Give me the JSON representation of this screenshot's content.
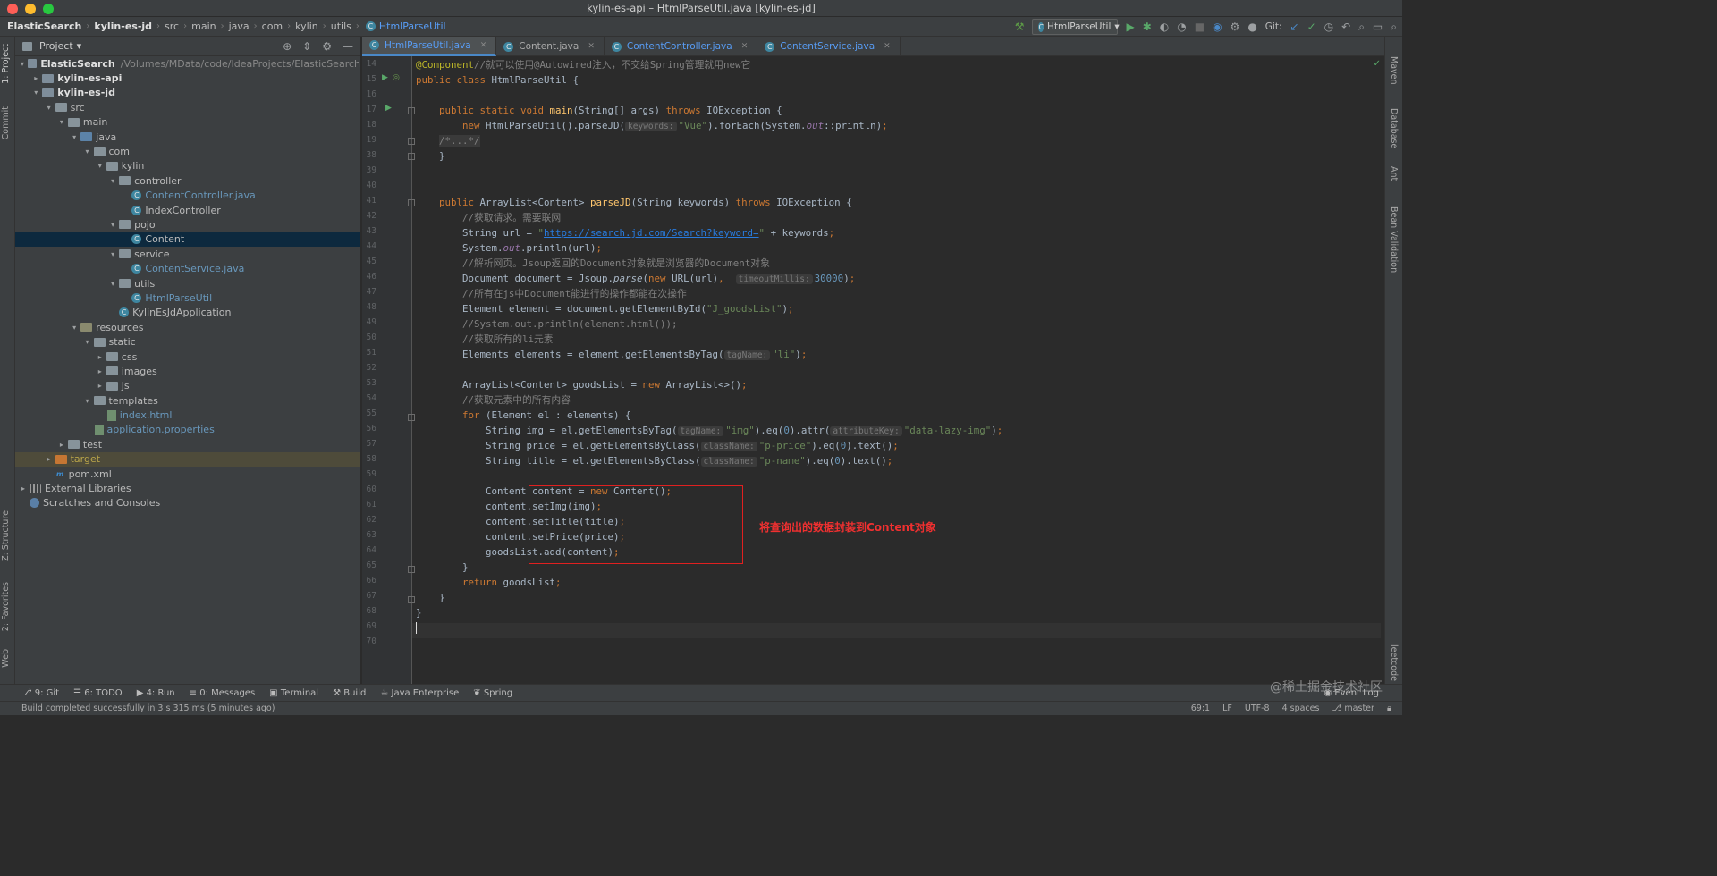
{
  "window": {
    "title": "kylin-es-api – HtmlParseUtil.java [kylin-es-jd]",
    "traffic_colors": [
      "#fe5f57",
      "#febc2e",
      "#28c840"
    ]
  },
  "breadcrumb": [
    "ElasticSearch",
    "kylin-es-jd",
    "src",
    "main",
    "java",
    "com",
    "kylin",
    "utils",
    "HtmlParseUtil"
  ],
  "toolbar": {
    "run_config": "HtmlParseUtil",
    "git_label": "Git:"
  },
  "left_strip": [
    "1: Project",
    "Commit",
    "Z: Structure",
    "2: Favorites",
    "Web"
  ],
  "right_strip": [
    "Maven",
    "Database",
    "Ant",
    "Bean Validation",
    "leetcode"
  ],
  "project": {
    "header": "Project",
    "tree": [
      {
        "label": "ElasticSearch",
        "suffix": "/Volumes/MData/code/IdeaProjects/ElasticSearch",
        "depth": 0,
        "arrow": "▾",
        "icon": "mod",
        "bold": true
      },
      {
        "label": "kylin-es-api",
        "depth": 1,
        "arrow": "▸",
        "icon": "mod",
        "bold": true
      },
      {
        "label": "kylin-es-jd",
        "depth": 1,
        "arrow": "▾",
        "icon": "mod",
        "bold": true
      },
      {
        "label": "src",
        "depth": 2,
        "arrow": "▾",
        "icon": "folder"
      },
      {
        "label": "main",
        "depth": 3,
        "arrow": "▾",
        "icon": "folder"
      },
      {
        "label": "java",
        "depth": 4,
        "arrow": "▾",
        "icon": "src"
      },
      {
        "label": "com",
        "depth": 5,
        "arrow": "▾",
        "icon": "folder"
      },
      {
        "label": "kylin",
        "depth": 6,
        "arrow": "▾",
        "icon": "folder"
      },
      {
        "label": "controller",
        "depth": 7,
        "arrow": "▾",
        "icon": "folder"
      },
      {
        "label": "ContentController.java",
        "depth": 8,
        "arrow": "",
        "icon": "class",
        "color": "blue"
      },
      {
        "label": "IndexController",
        "depth": 8,
        "arrow": "",
        "icon": "class"
      },
      {
        "label": "pojo",
        "depth": 7,
        "arrow": "▾",
        "icon": "folder"
      },
      {
        "label": "Content",
        "depth": 8,
        "arrow": "",
        "icon": "class",
        "selected": true
      },
      {
        "label": "service",
        "depth": 7,
        "arrow": "▾",
        "icon": "folder"
      },
      {
        "label": "ContentService.java",
        "depth": 8,
        "arrow": "",
        "icon": "class",
        "color": "blue"
      },
      {
        "label": "utils",
        "depth": 7,
        "arrow": "▾",
        "icon": "folder"
      },
      {
        "label": "HtmlParseUtil",
        "depth": 8,
        "arrow": "",
        "icon": "class",
        "color": "blue"
      },
      {
        "label": "KylinEsJdApplication",
        "depth": 7,
        "arrow": "",
        "icon": "class"
      },
      {
        "label": "resources",
        "depth": 4,
        "arrow": "▾",
        "icon": "res"
      },
      {
        "label": "static",
        "depth": 5,
        "arrow": "▾",
        "icon": "folder"
      },
      {
        "label": "css",
        "depth": 6,
        "arrow": "▸",
        "icon": "folder"
      },
      {
        "label": "images",
        "depth": 6,
        "arrow": "▸",
        "icon": "folder"
      },
      {
        "label": "js",
        "depth": 6,
        "arrow": "▸",
        "icon": "folder"
      },
      {
        "label": "templates",
        "depth": 5,
        "arrow": "▾",
        "icon": "folder"
      },
      {
        "label": "index.html",
        "depth": 6,
        "arrow": "",
        "icon": "file",
        "color": "blue"
      },
      {
        "label": "application.properties",
        "depth": 5,
        "arrow": "",
        "icon": "file",
        "color": "blue"
      },
      {
        "label": "test",
        "depth": 3,
        "arrow": "▸",
        "icon": "folder"
      },
      {
        "label": "target",
        "depth": 2,
        "arrow": "▸",
        "icon": "orange",
        "color": "olive",
        "target": true
      },
      {
        "label": "pom.xml",
        "depth": 2,
        "arrow": "",
        "icon": "m"
      },
      {
        "label": "External Libraries",
        "depth": 0,
        "arrow": "▸",
        "icon": "lib"
      },
      {
        "label": "Scratches and Consoles",
        "depth": 0,
        "arrow": "",
        "icon": "scratch"
      }
    ]
  },
  "tabs": [
    {
      "label": "HtmlParseUtil.java",
      "active": true
    },
    {
      "label": "Content.java",
      "active": false
    },
    {
      "label": "ContentController.java",
      "active": false
    },
    {
      "label": "ContentService.java",
      "active": false
    }
  ],
  "editor": {
    "line_numbers": [
      "14",
      "15",
      "16",
      "17",
      "18",
      "19",
      "38",
      "39",
      "40",
      "41",
      "42",
      "43",
      "44",
      "45",
      "46",
      "47",
      "48",
      "49",
      "50",
      "51",
      "52",
      "53",
      "54",
      "55",
      "56",
      "57",
      "58",
      "59",
      "60",
      "61",
      "62",
      "63",
      "64",
      "65",
      "66",
      "67",
      "68",
      "69",
      "70"
    ],
    "annotation_label": "将查询出的数据封装到Content对象"
  },
  "bottom_tools": [
    "9: Git",
    "6: TODO",
    "4: Run",
    "0: Messages",
    "Terminal",
    "Build",
    "Java Enterprise",
    "Spring"
  ],
  "event_log": "Event Log",
  "status": {
    "message": "Build completed successfully in 3 s 315 ms (5 minutes ago)",
    "position": "69:1",
    "line_sep": "LF",
    "encoding": "UTF-8",
    "indent": "4 spaces",
    "branch": "master"
  },
  "watermark": "@稀土掘金技术社区"
}
